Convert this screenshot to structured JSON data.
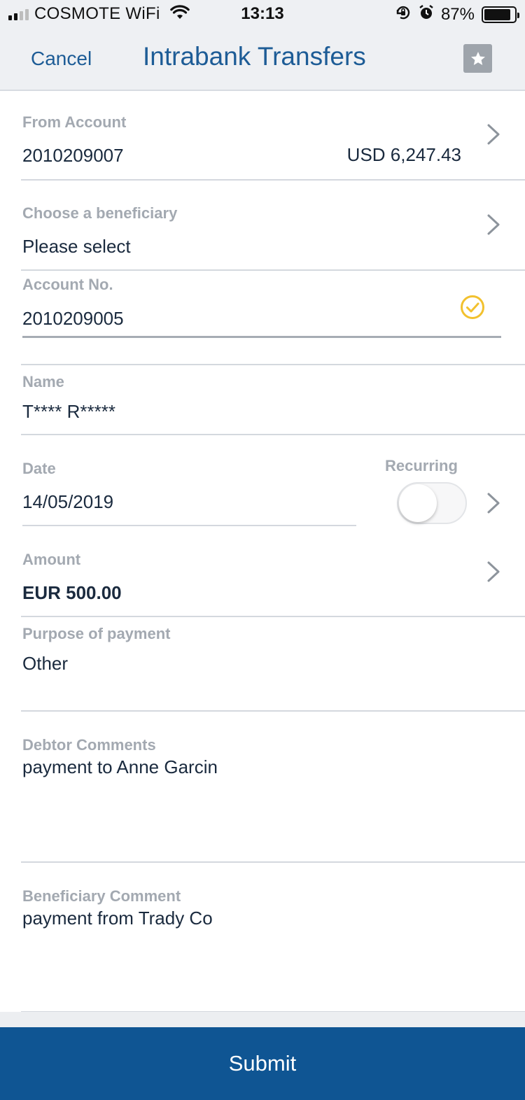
{
  "status_bar": {
    "carrier": "COSMOTE WiFi",
    "time": "13:13",
    "battery_percent": "87%",
    "battery_level": 0.87
  },
  "nav": {
    "cancel_label": "Cancel",
    "title": "Intrabank Transfers",
    "favorite_icon": "star-icon"
  },
  "from_account": {
    "label": "From Account",
    "account": "2010209007",
    "balance": "USD 6,247.43"
  },
  "beneficiary": {
    "label": "Choose a beneficiary",
    "value": "Please select"
  },
  "account_no": {
    "label": "Account No.",
    "value": "2010209005",
    "verified_icon": "check-circle-icon"
  },
  "name": {
    "label": "Name",
    "value": "T**** R*****"
  },
  "date": {
    "label": "Date",
    "value": "14/05/2019"
  },
  "recurring": {
    "label": "Recurring",
    "enabled": false
  },
  "amount": {
    "label": "Amount",
    "value": "EUR 500.00"
  },
  "purpose": {
    "label": "Purpose of payment",
    "value": "Other"
  },
  "debtor_comments": {
    "label": "Debtor Comments",
    "value": "payment to Anne Garcin"
  },
  "beneficiary_comment": {
    "label": "Beneficiary Comment",
    "value": "payment from Trady Co"
  },
  "submit_label": "Submit",
  "colors": {
    "brand_blue": "#0f5593",
    "link_blue": "#1d5c96",
    "check_yellow": "#f2c12e",
    "label_gray": "#a3a9b1"
  }
}
